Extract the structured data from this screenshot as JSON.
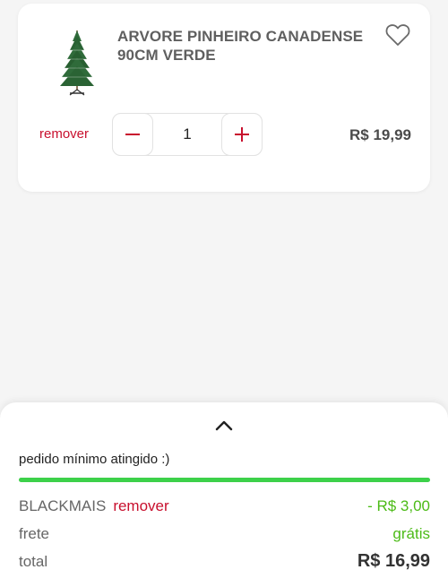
{
  "product": {
    "title": "ARVORE PINHEIRO CANADENSE 90CM VERDE",
    "remove_label": "remover",
    "quantity": "1",
    "price": "R$ 19,99"
  },
  "summary": {
    "min_order_text": "pedido mínimo atingido :)",
    "progress": 1.0,
    "coupon_code": "BLACKMAIS",
    "coupon_remove_label": "remover",
    "discount": "- R$ 3,00",
    "shipping_label": "frete",
    "shipping_value": "grátis",
    "total_label": "total",
    "total_value": "R$ 16,99"
  },
  "colors": {
    "accent_red": "#c8102e",
    "success_green": "#3dd14a",
    "text_green": "#4cbb17"
  },
  "icons": [
    "christmas-tree-image",
    "heart-icon",
    "minus-icon",
    "plus-icon",
    "chevron-up-icon"
  ]
}
